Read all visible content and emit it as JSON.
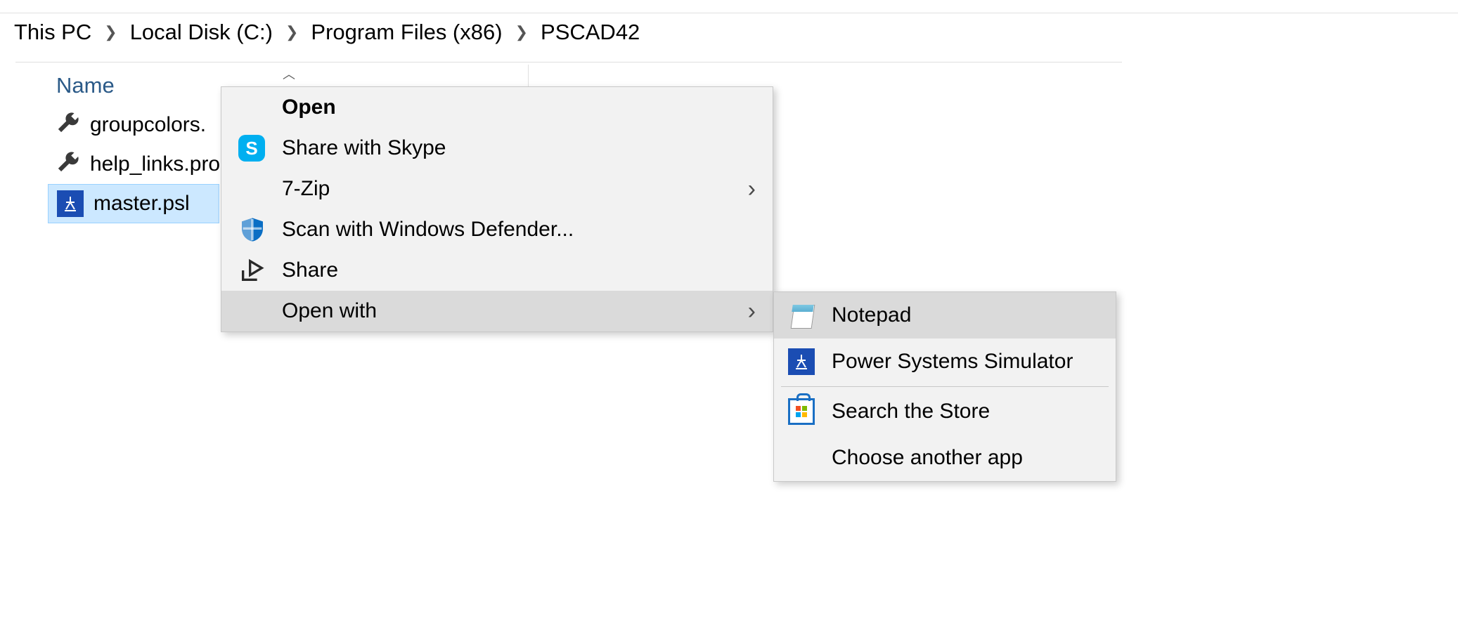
{
  "breadcrumb": {
    "items": [
      "This PC",
      "Local Disk (C:)",
      "Program Files (x86)",
      "PSCAD42"
    ]
  },
  "column_header": "Name",
  "files": [
    {
      "name": "groupcolors.",
      "icon": "wrench",
      "selected": false
    },
    {
      "name": "help_links.pro",
      "icon": "wrench",
      "selected": false
    },
    {
      "name": "master.psl",
      "icon": "psl",
      "selected": true
    }
  ],
  "context_menu": {
    "items": [
      {
        "label": "Open",
        "bold": true,
        "icon": null,
        "arrow": false
      },
      {
        "label": "Share with Skype",
        "icon": "skype",
        "arrow": false
      },
      {
        "label": "7-Zip",
        "icon": null,
        "arrow": true
      },
      {
        "label": "Scan with Windows Defender...",
        "icon": "defender",
        "arrow": false
      },
      {
        "label": "Share",
        "icon": "share",
        "arrow": false
      },
      {
        "label": "Open with",
        "icon": null,
        "arrow": true,
        "hover": true
      }
    ]
  },
  "submenu": {
    "items": [
      {
        "label": "Notepad",
        "icon": "notepad",
        "hover": true
      },
      {
        "label": "Power Systems Simulator",
        "icon": "psl"
      },
      {
        "type": "divider"
      },
      {
        "label": "Search the Store",
        "icon": "store"
      },
      {
        "label": "Choose another app",
        "icon": null
      }
    ]
  }
}
